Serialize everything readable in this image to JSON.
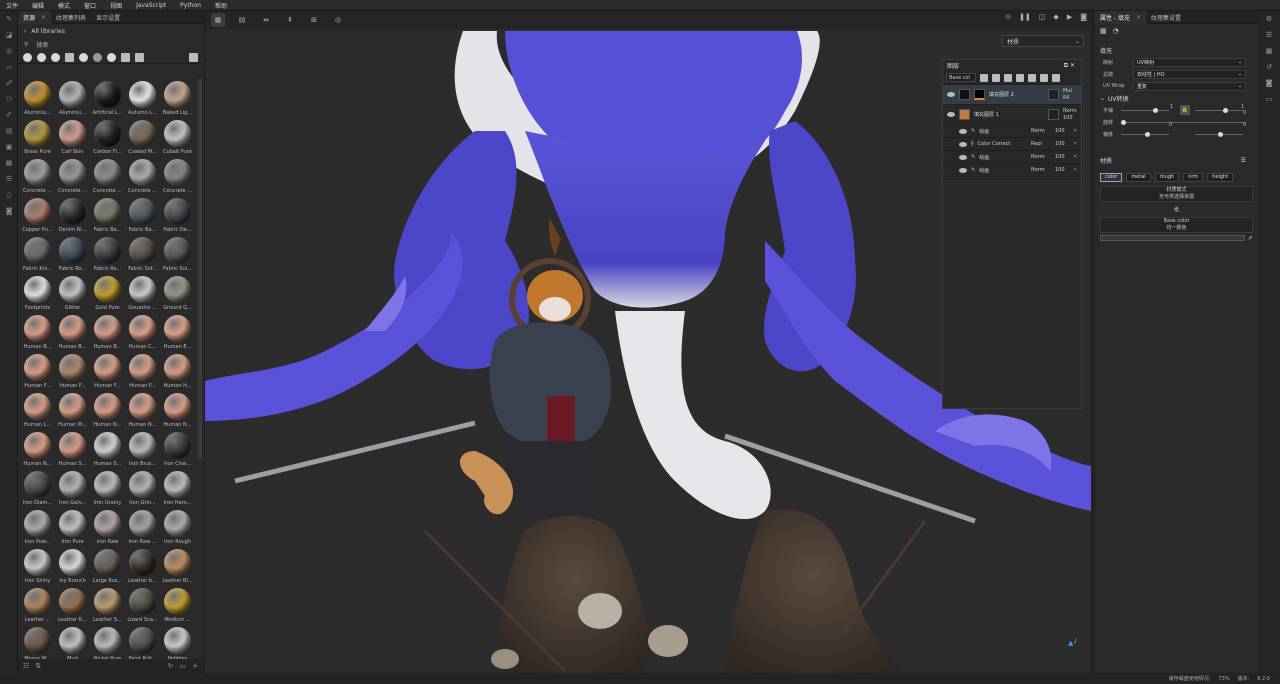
{
  "menu": [
    "文件",
    "编辑",
    "模式",
    "窗口",
    "视图",
    "JavaScript",
    "Python",
    "帮助"
  ],
  "left_panel": {
    "tabs": [
      {
        "label": "资源",
        "closable": true
      },
      {
        "label": "纹理集列表"
      },
      {
        "label": "显示设置"
      }
    ],
    "library": "All libraries",
    "search_placeholder": "搜索",
    "materials": [
      {
        "label": "Aluminiu...",
        "c": "#c9942e"
      },
      {
        "label": "Aluminiu...",
        "c": "#b8b8b8"
      },
      {
        "label": "Artificial L...",
        "c": "#1b1b1b"
      },
      {
        "label": "Autumn L...",
        "c": "#eeeeee"
      },
      {
        "label": "Baked Lig...",
        "c": "#c9a890"
      },
      {
        "label": "Brass Pure",
        "c": "#b89a40"
      },
      {
        "label": "Calf Skin",
        "c": "#d8a090"
      },
      {
        "label": "Carbon Fi...",
        "c": "#222222"
      },
      {
        "label": "Coated M...",
        "c": "#7a6a55"
      },
      {
        "label": "Cobalt Pure",
        "c": "#c8c8cc"
      },
      {
        "label": "Concrete ...",
        "c": "#a0a0a0"
      },
      {
        "label": "Concrete ...",
        "c": "#9a9a9a"
      },
      {
        "label": "Concrete ...",
        "c": "#8e8e8e"
      },
      {
        "label": "Concrete ...",
        "c": "#b0b0b0"
      },
      {
        "label": "Concrete ...",
        "c": "#888888"
      },
      {
        "label": "Copper Pu...",
        "c": "#b08070"
      },
      {
        "label": "Denim Ri...",
        "c": "#2a2a2a"
      },
      {
        "label": "Fabric Ba...",
        "c": "#7a7a6a"
      },
      {
        "label": "Fabric Ba...",
        "c": "#505a64"
      },
      {
        "label": "Fabric De...",
        "c": "#444a50"
      },
      {
        "label": "Fabric Kni...",
        "c": "#6a6e72"
      },
      {
        "label": "Fabric Ro...",
        "c": "#3e4c5c"
      },
      {
        "label": "Fabric Ro...",
        "c": "#3a3d42"
      },
      {
        "label": "Fabric Sof...",
        "c": "#5a5048"
      },
      {
        "label": "Fabric Sui...",
        "c": "#585858"
      },
      {
        "label": "Footprints",
        "c": "#e8e8e8"
      },
      {
        "label": "Glitter",
        "c": "#c8c8c8"
      },
      {
        "label": "Gold Pure",
        "c": "#c8a030"
      },
      {
        "label": "Gouache ...",
        "c": "#d0d0d0"
      },
      {
        "label": "Ground G...",
        "c": "#9a9888"
      },
      {
        "label": "Human B...",
        "c": "#e0a088"
      },
      {
        "label": "Human B...",
        "c": "#dfa088"
      },
      {
        "label": "Human B...",
        "c": "#dea090"
      },
      {
        "label": "Human C...",
        "c": "#e0a28a"
      },
      {
        "label": "Human E...",
        "c": "#e2a48c"
      },
      {
        "label": "Human F...",
        "c": "#e0a088"
      },
      {
        "label": "Human F...",
        "c": "#b08a70"
      },
      {
        "label": "Human F...",
        "c": "#dfa088"
      },
      {
        "label": "Human F...",
        "c": "#e0a088"
      },
      {
        "label": "Human H...",
        "c": "#e0a088"
      },
      {
        "label": "Human L...",
        "c": "#e0a088"
      },
      {
        "label": "Human M...",
        "c": "#dfa08a"
      },
      {
        "label": "Human N...",
        "c": "#e0a088"
      },
      {
        "label": "Human N...",
        "c": "#dfa088"
      },
      {
        "label": "Human N...",
        "c": "#e0a088"
      },
      {
        "label": "Human N...",
        "c": "#e0a088"
      },
      {
        "label": "Human S...",
        "c": "#dea088"
      },
      {
        "label": "Human S...",
        "c": "#d8d8d8"
      },
      {
        "label": "Iron Brus...",
        "c": "#c0c0c0"
      },
      {
        "label": "Iron Chai...",
        "c": "#3a3a3a"
      },
      {
        "label": "Iron Diam...",
        "c": "#4a4a4a"
      },
      {
        "label": "Iron Galv...",
        "c": "#b8b8b8"
      },
      {
        "label": "Iron Grainy",
        "c": "#c0c0c0"
      },
      {
        "label": "Iron Grin...",
        "c": "#b8b8b8"
      },
      {
        "label": "Iron Ham...",
        "c": "#c0c0c0"
      },
      {
        "label": "Iron Pow...",
        "c": "#b0b0b0"
      },
      {
        "label": "Iron Pure",
        "c": "#c8c8c8"
      },
      {
        "label": "Iron Raw",
        "c": "#b8a8a8"
      },
      {
        "label": "Iron Raw ...",
        "c": "#a8a8a8"
      },
      {
        "label": "Iron Rough",
        "c": "#b0b0b0"
      },
      {
        "label": "Iron Shiny",
        "c": "#d0d0d0"
      },
      {
        "label": "Ivy Branch",
        "c": "#e0e0e0"
      },
      {
        "label": "Large Rus...",
        "c": "#6a6058"
      },
      {
        "label": "Leather b...",
        "c": "#3a3026"
      },
      {
        "label": "Leather Bl...",
        "c": "#c09060"
      },
      {
        "label": "Leather ...",
        "c": "#b08860"
      },
      {
        "label": "Leather R...",
        "c": "#9a7050"
      },
      {
        "label": "Leather S...",
        "c": "#c0a070"
      },
      {
        "label": "Lizard Sca...",
        "c": "#4a5040"
      },
      {
        "label": "Medium ...",
        "c": "#c8a030"
      },
      {
        "label": "Mossy W...",
        "c": "#6a5a48"
      },
      {
        "label": "Mud",
        "c": "#c8c8c8"
      },
      {
        "label": "Nickel Pure",
        "c": "#c0c0c0"
      },
      {
        "label": "Paint Roll...",
        "c": "#505050"
      },
      {
        "label": "Pebbles",
        "c": "#d0d0d0"
      }
    ]
  },
  "viewport": {
    "material_select": "材质",
    "layers_panel": {
      "title": "图层",
      "channel": "Base col",
      "layers": [
        {
          "name": "填充图层 2",
          "blend": "Mul",
          "opacity": "64",
          "selected": true,
          "thumb": "#111111"
        },
        {
          "name": "填充图层 1",
          "blend": "Norm",
          "opacity": "100",
          "selected": false,
          "thumb": "#c07a40"
        }
      ],
      "sublayers": [
        {
          "name": "绘画",
          "blend": "Norm",
          "opacity": "100"
        },
        {
          "name": "Color Correct",
          "blend": "Repl",
          "opacity": "100"
        },
        {
          "name": "绘画",
          "blend": "Norm",
          "opacity": "100"
        },
        {
          "name": "绘画",
          "blend": "Norm",
          "opacity": "100"
        }
      ]
    }
  },
  "properties": {
    "tabs": [
      {
        "label": "属性 - 填充",
        "closable": true
      },
      {
        "label": "纹理集设置"
      }
    ],
    "section_fill": "填充",
    "mapping_label": "映射",
    "mapping_value": "UV映射",
    "filter_label": "滤镜",
    "filter_value": "双线性 | HQ",
    "uvwrap_label": "UV Wrap",
    "uvwrap_value": "重复",
    "uv_transform": "UV转换",
    "scale_label": "平铺",
    "scale_value": "1",
    "scale_max": "1",
    "rotation_label": "旋转",
    "rotation_value": "0",
    "offset_label": "偏移",
    "offset_x": "0",
    "offset_y": "0",
    "material_section": "材质",
    "chips": [
      {
        "label": "color",
        "on": true
      },
      {
        "label": "metal"
      },
      {
        "label": "rough"
      },
      {
        "label": "nrm"
      },
      {
        "label": "height"
      }
    ],
    "material_mode_title": "材质模式",
    "material_mode_sub": "无可供选择资源",
    "basecolor_header": "纸",
    "basecolor_title": "Base color",
    "basecolor_sub": "均一颜色"
  },
  "status": {
    "text": "缓存磁盘使用情况:",
    "zoom": "73%",
    "version_label": "版本:",
    "version": "8.2.0"
  }
}
